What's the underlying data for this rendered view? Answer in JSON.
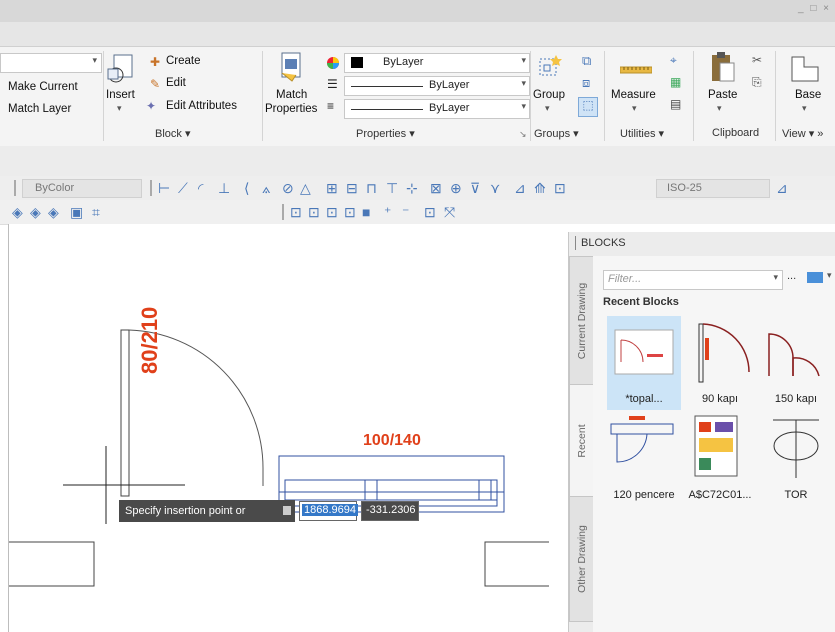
{
  "window_controls": "_ □ ×",
  "ribbon": {
    "layer": {
      "make_current": "Make Current",
      "match_layer": "Match Layer"
    },
    "block": {
      "insert": "Insert",
      "create": "Create",
      "edit": "Edit",
      "edit_attributes": "Edit Attributes",
      "panel_label": "Block ▾"
    },
    "properties": {
      "match_line1": "Match",
      "match_line2": "Properties",
      "color_value": "ByLayer",
      "linetype_value": "ByLayer",
      "lineweight_value": "ByLayer",
      "panel_label": "Properties ▾"
    },
    "groups": {
      "group": "Group",
      "panel_label": "Groups ▾"
    },
    "utilities": {
      "measure": "Measure",
      "panel_label": "Utilities ▾"
    },
    "clipboard": {
      "paste": "Paste",
      "panel_label": "Clipboard"
    },
    "view": {
      "base": "Base",
      "panel_label": "View ▾ »"
    }
  },
  "toolbar": {
    "color_combo": "ByColor",
    "dimstyle": "ISO-25"
  },
  "drawing": {
    "door_label": "80/210",
    "window_label": "100/140"
  },
  "command": {
    "prompt": "Specify insertion point or",
    "x_value": "1868.9694",
    "y_value": "-331.2306"
  },
  "blocks_palette": {
    "title": "BLOCKS",
    "filter_placeholder": "Filter...",
    "more": "...",
    "recent_header": "Recent Blocks",
    "side_tabs": {
      "current": "Current Drawing",
      "recent": "Recent",
      "other": "Other Drawing"
    },
    "items": [
      {
        "label": "*topal..."
      },
      {
        "label": "90 kapı"
      },
      {
        "label": "150 kapı"
      },
      {
        "label": "120 pencere"
      },
      {
        "label": "A$C72C01..."
      },
      {
        "label": "TOR"
      }
    ]
  },
  "colors": {
    "accent": "#2f6db5",
    "drawing_red": "#e0401a",
    "selected_tile": "#cce4f7"
  }
}
